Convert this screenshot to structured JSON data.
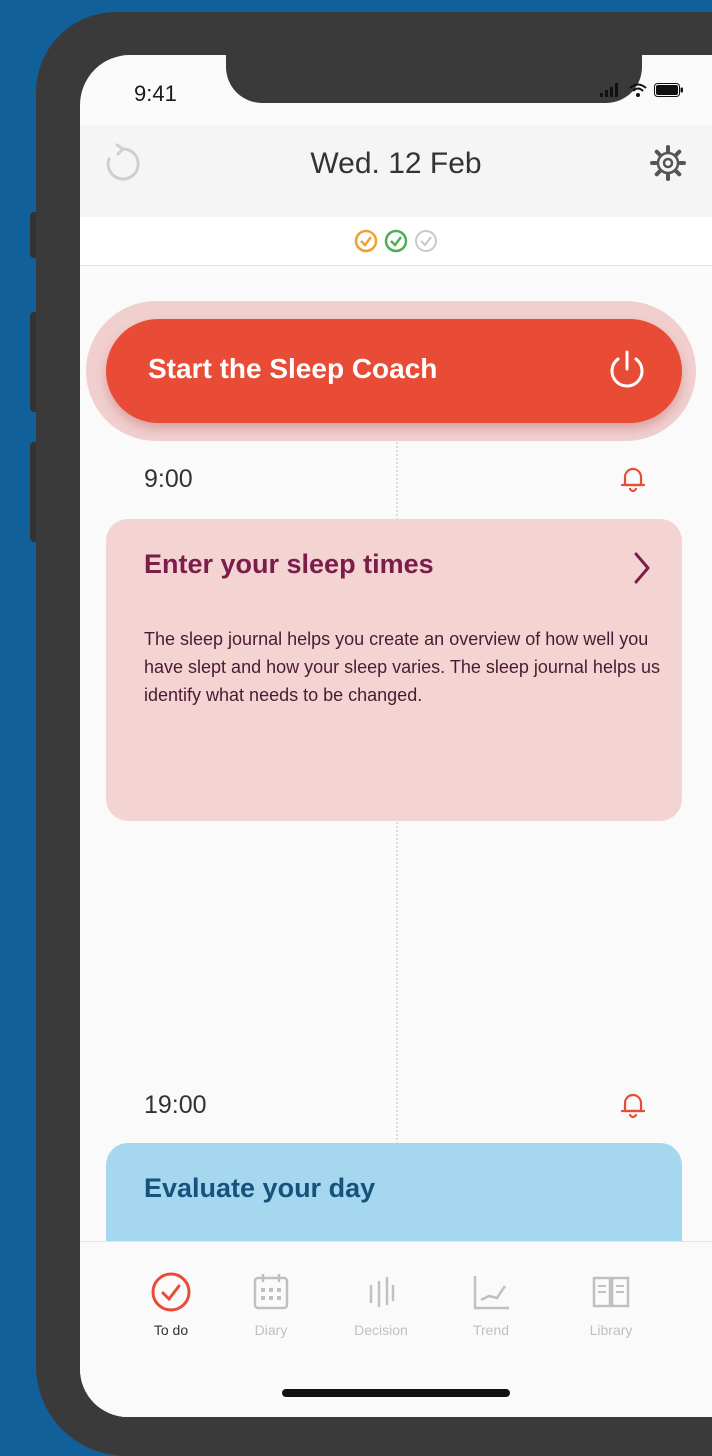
{
  "status_bar": {
    "time": "9:41",
    "icons": [
      "signal-icon",
      "wifi-icon",
      "battery-icon"
    ]
  },
  "header": {
    "date": "Wed. 12 Feb",
    "left_icon": "refresh-icon",
    "right_icon": "gear-icon"
  },
  "progress_checks": [
    {
      "icon": "check-circle-icon",
      "color": "#f0a030"
    },
    {
      "icon": "check-circle-icon",
      "color": "#4caf50"
    },
    {
      "icon": "check-circle-icon",
      "color": "#c8c8c8"
    }
  ],
  "coach": {
    "label": "Start the Sleep Coach",
    "icon": "power-icon"
  },
  "schedule": [
    {
      "time": "9:00",
      "title": "Enter your sleep times",
      "description": "The sleep journal helps you create an overview of how well you have slept and how your sleep varies. The sleep journal helps us identify what needs to be changed."
    },
    {
      "time": "19:00",
      "title": "Evaluate your day"
    }
  ],
  "tabs": [
    {
      "label": "To do",
      "icon": "check-circle-icon",
      "active": true
    },
    {
      "label": "Diary",
      "icon": "calendar-icon",
      "active": false
    },
    {
      "label": "Decision",
      "icon": "decision-icon",
      "active": false
    },
    {
      "label": "Trend",
      "icon": "trend-icon",
      "active": false
    },
    {
      "label": "Library",
      "icon": "book-icon",
      "active": false
    }
  ],
  "colors": {
    "background": "#12609a",
    "coach_button": "#e84c37",
    "sleep_card": "#f4d3d3",
    "evaluate_card": "#a5d8ef",
    "card_title": "#7a1d4a",
    "evaluate_title": "#16527e"
  }
}
